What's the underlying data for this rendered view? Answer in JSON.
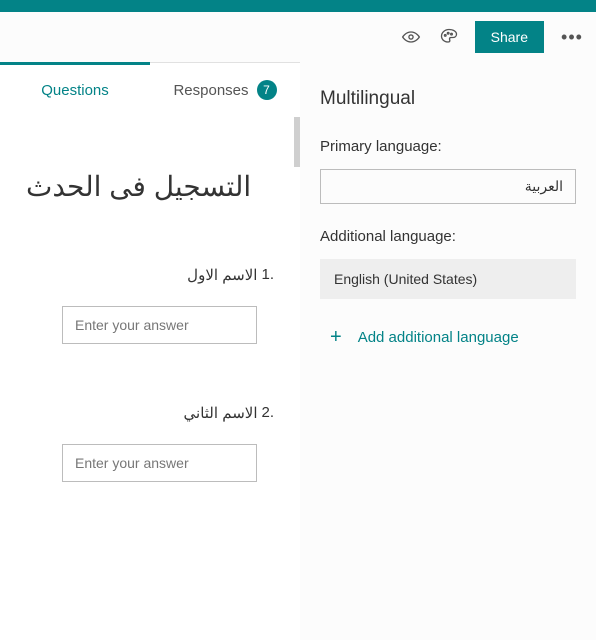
{
  "toolbar": {
    "share_label": "Share"
  },
  "tabs": {
    "questions_label": "Questions",
    "responses_label": "Responses",
    "responses_count": "7"
  },
  "form": {
    "title": "التسجيل فى الحدث",
    "q1_number": "1.",
    "q1_label": "الاسم الاول",
    "q2_number": "2.",
    "q2_label": "الاسم الثاني",
    "answer_placeholder": "Enter your answer"
  },
  "panel": {
    "title": "Multilingual",
    "primary_label": "Primary language:",
    "primary_value": "العربية",
    "additional_label": "Additional language:",
    "additional_value": "English (United States)",
    "add_label": "Add additional language"
  }
}
